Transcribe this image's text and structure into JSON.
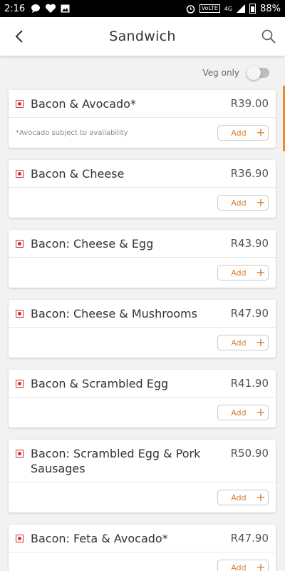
{
  "status_bar": {
    "time": "2:16",
    "network": "VoLTE",
    "signal": "4G",
    "battery": "88%"
  },
  "header": {
    "title": "Sandwich",
    "back_icon": "back-arrow-icon",
    "search_icon": "search-icon"
  },
  "filter": {
    "veg_only_label": "Veg only",
    "veg_only_enabled": false
  },
  "colors": {
    "accent": "#e07b2c",
    "nonveg_marker": "#d32f2f",
    "scroll_indicator": "#f08a2b"
  },
  "items": [
    {
      "name": "Bacon & Avocado*",
      "price": "R39.00",
      "note": "*Avocado subject to availability",
      "add_label": "Add"
    },
    {
      "name": "Bacon & Cheese",
      "price": "R36.90",
      "note": "",
      "add_label": "Add"
    },
    {
      "name": "Bacon: Cheese & Egg",
      "price": "R43.90",
      "note": "",
      "add_label": "Add"
    },
    {
      "name": "Bacon: Cheese & Mushrooms",
      "price": "R47.90",
      "note": "",
      "add_label": "Add"
    },
    {
      "name": "Bacon & Scrambled Egg",
      "price": "R41.90",
      "note": "",
      "add_label": "Add"
    },
    {
      "name": "Bacon: Scrambled Egg & Pork Sausages",
      "price": "R50.90",
      "note": "",
      "add_label": "Add"
    },
    {
      "name": "Bacon: Feta & Avocado*",
      "price": "R47.90",
      "note": "",
      "add_label": "Add"
    }
  ]
}
